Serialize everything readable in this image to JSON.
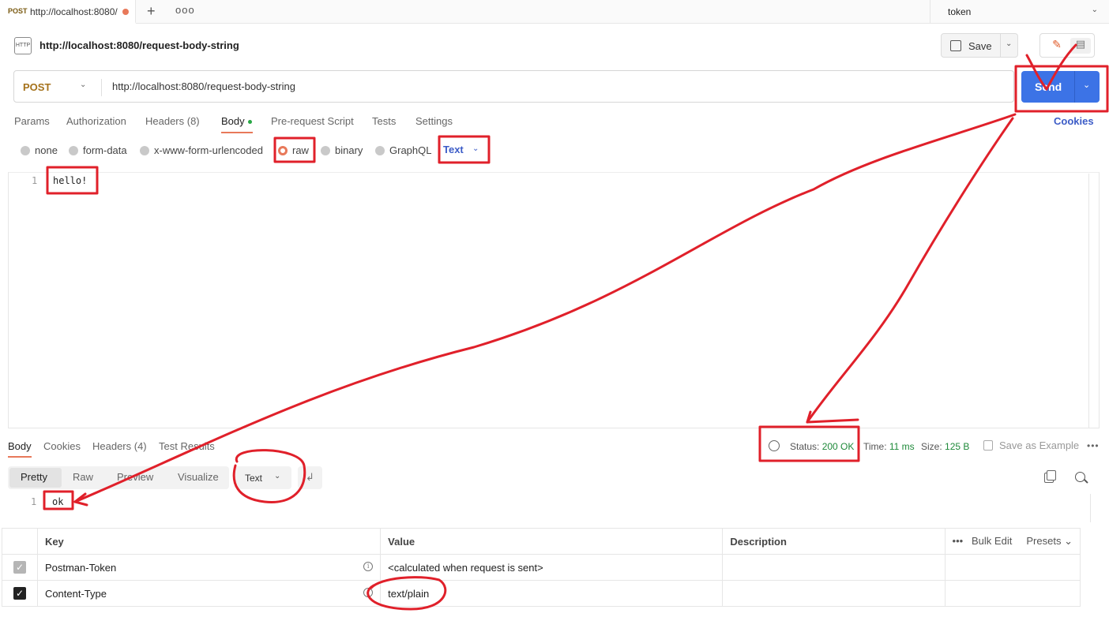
{
  "tab": {
    "method": "POST",
    "url": "http://localhost:8080/",
    "plus": "+",
    "more": "ooo"
  },
  "environment": {
    "label": "token"
  },
  "request": {
    "icon_label": "HTTP",
    "title": "http://localhost:8080/request-body-string",
    "save_label": "Save",
    "method": "POST",
    "url": "http://localhost:8080/request-body-string",
    "send_label": "Send"
  },
  "request_tabs": [
    "Params",
    "Authorization",
    "Headers (8)",
    "Body",
    "Pre-request Script",
    "Tests",
    "Settings"
  ],
  "cookies_link": "Cookies",
  "body_types": [
    "none",
    "form-data",
    "x-www-form-urlencoded",
    "raw",
    "binary",
    "GraphQL"
  ],
  "body_format": "Text",
  "editor": {
    "line_no": "1",
    "content": "hello!"
  },
  "response": {
    "tabs": [
      "Body",
      "Cookies",
      "Headers (4)",
      "Test Results"
    ],
    "status_prefix": "Status: ",
    "status": "200 OK",
    "time_prefix": "Time: ",
    "time": "11 ms",
    "size_prefix": "Size: ",
    "size": "125 B",
    "save_example": "Save as Example",
    "views": [
      "Pretty",
      "Raw",
      "Preview",
      "Visualize"
    ],
    "format": "Text",
    "line_no": "1",
    "content": "ok"
  },
  "headers_table": {
    "columns": {
      "key": "Key",
      "value": "Value",
      "description": "Description"
    },
    "bulk_edit": "Bulk Edit",
    "presets": "Presets",
    "rows": [
      {
        "key": "Postman-Token",
        "value": "<calculated when request is sent>"
      },
      {
        "key": "Content-Type",
        "value": "text/plain"
      }
    ]
  },
  "colors": {
    "accent": "#e8795a",
    "send": "#3c73e6",
    "annotation": "#e0202a"
  }
}
